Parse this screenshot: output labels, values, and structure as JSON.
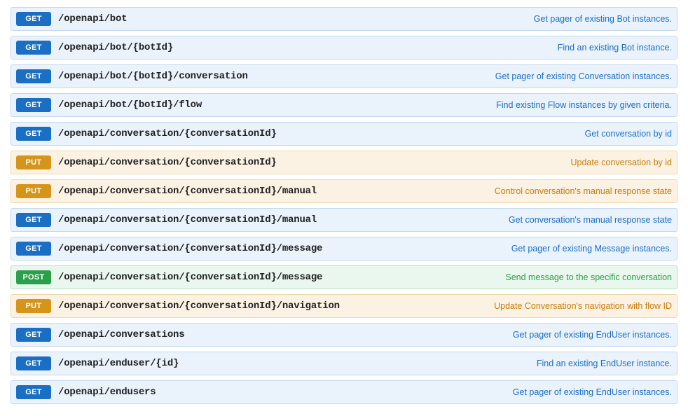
{
  "endpoints": [
    {
      "method": "GET",
      "path": "/openapi/bot",
      "desc": "Get pager of existing Bot instances."
    },
    {
      "method": "GET",
      "path": "/openapi/bot/{botId}",
      "desc": "Find an existing Bot instance."
    },
    {
      "method": "GET",
      "path": "/openapi/bot/{botId}/conversation",
      "desc": "Get pager of existing Conversation instances."
    },
    {
      "method": "GET",
      "path": "/openapi/bot/{botId}/flow",
      "desc": "Find existing Flow instances by given criteria."
    },
    {
      "method": "GET",
      "path": "/openapi/conversation/{conversationId}",
      "desc": "Get conversation by id"
    },
    {
      "method": "PUT",
      "path": "/openapi/conversation/{conversationId}",
      "desc": "Update conversation by id"
    },
    {
      "method": "PUT",
      "path": "/openapi/conversation/{conversationId}/manual",
      "desc": "Control conversation's manual response state"
    },
    {
      "method": "GET",
      "path": "/openapi/conversation/{conversationId}/manual",
      "desc": "Get conversation's manual response state"
    },
    {
      "method": "GET",
      "path": "/openapi/conversation/{conversationId}/message",
      "desc": "Get pager of existing Message instances."
    },
    {
      "method": "POST",
      "path": "/openapi/conversation/{conversationId}/message",
      "desc": "Send message to the specific conversation"
    },
    {
      "method": "PUT",
      "path": "/openapi/conversation/{conversationId}/navigation",
      "desc": "Update Conversation's navigation with flow ID"
    },
    {
      "method": "GET",
      "path": "/openapi/conversations",
      "desc": "Get pager of existing EndUser instances."
    },
    {
      "method": "GET",
      "path": "/openapi/enduser/{id}",
      "desc": "Find an existing EndUser instance."
    },
    {
      "method": "GET",
      "path": "/openapi/endusers",
      "desc": "Get pager of existing EndUser instances."
    }
  ]
}
